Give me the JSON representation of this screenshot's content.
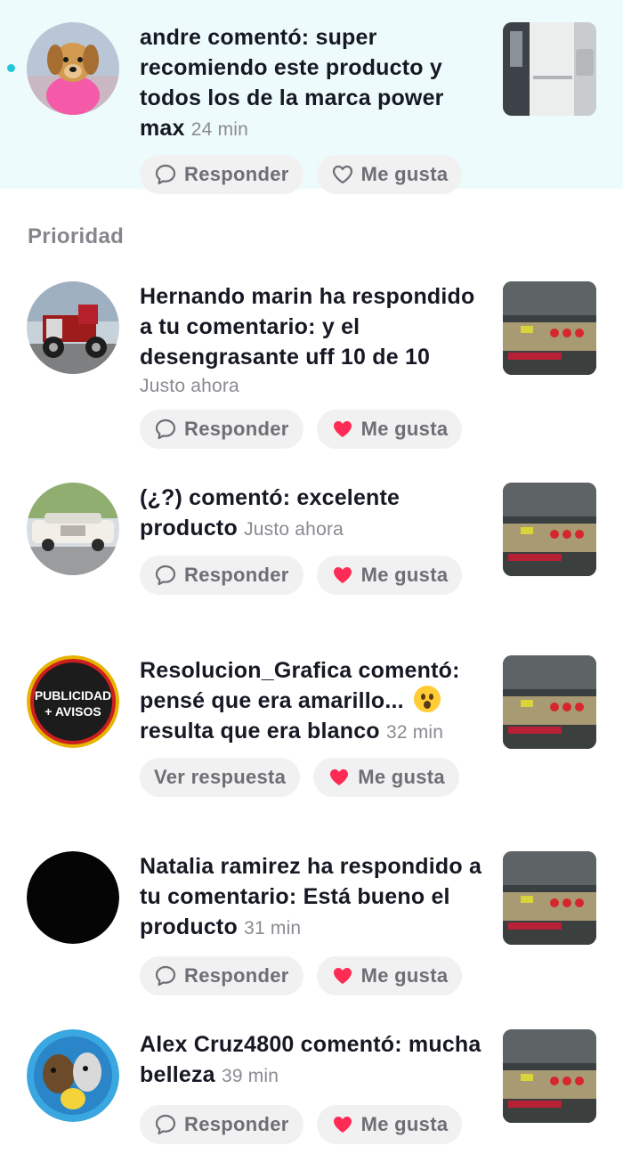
{
  "section_title": "Prioridad",
  "actions": {
    "reply": "Responder",
    "like": "Me gusta",
    "view_reply": "Ver respuesta"
  },
  "notifications": [
    {
      "text": "andre comentó: super recomiendo este producto y todos los de la marca power max",
      "time": "24 min",
      "unread": true,
      "liked": false,
      "avatar_icon": "puppy-avatar",
      "thumbnail_icon": "truck-side-thumbnail"
    },
    {
      "text": "Hernando marin ha respondido a tu comentario: y el desengrasante uff 10 de 10",
      "time": "Justo ahora",
      "liked": true,
      "avatar_icon": "red-truck-avatar",
      "thumbnail_icon": "truck-rear-thumbnail"
    },
    {
      "text": "(¿?) comentó: excelente producto",
      "time": "Justo ahora",
      "liked": true,
      "avatar_icon": "white-car-avatar",
      "thumbnail_icon": "truck-rear-thumbnail"
    },
    {
      "text": "Resolucion_Grafica comentó: pensé que era amarillo... ",
      "text_after_emoji": "resulta que era blanco",
      "emoji": "surprised-face-emoji",
      "time": "32 min",
      "liked": true,
      "avatar_logo_line1": "PUBLICIDAD",
      "avatar_logo_line2": "+ AVISOS",
      "avatar_icon": "publicidad-avisos-logo",
      "thumbnail_icon": "truck-rear-thumbnail"
    },
    {
      "text": "Natalia ramirez ha respondido a tu comentario: Está bueno el producto",
      "time": "31 min",
      "liked": true,
      "avatar_icon": "black-avatar",
      "thumbnail_icon": "truck-rear-thumbnail"
    },
    {
      "text": "Alex Cruz4800 comentó: mucha belleza",
      "time": "39 min",
      "liked": true,
      "avatar_icon": "cartoon-avatar",
      "thumbnail_icon": "truck-rear-thumbnail"
    }
  ],
  "colors": {
    "highlight_bg": "#eefbfc",
    "unread_dot": "#25c6d8",
    "like_red": "#fe2c55",
    "pill_bg": "#f1f1f2"
  }
}
